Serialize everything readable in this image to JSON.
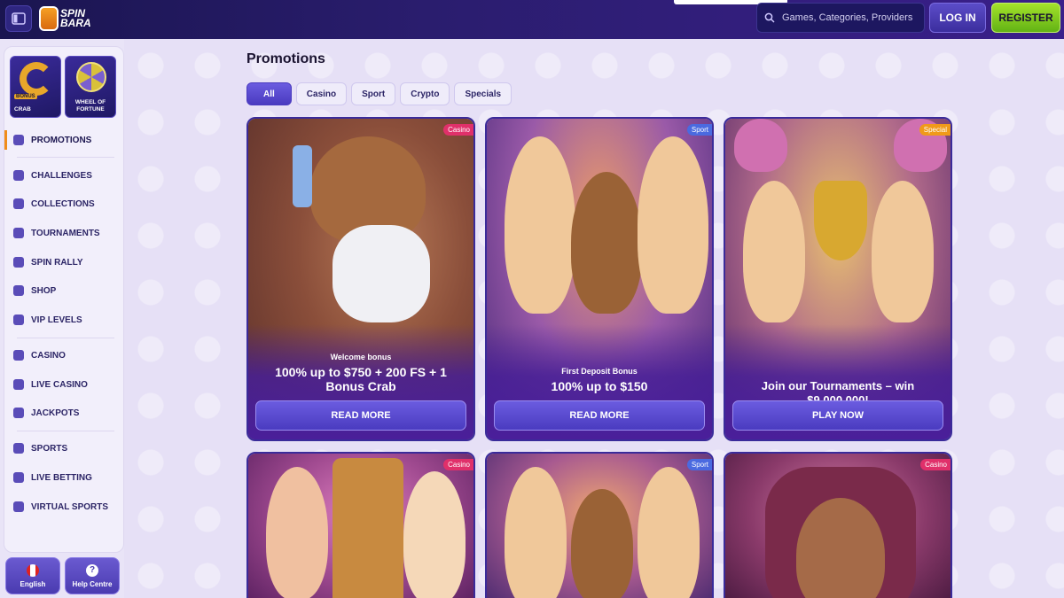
{
  "header": {
    "logo_text_top": "SPIN",
    "logo_text_bottom": "BARA",
    "search_placeholder": "Games, Categories, Providers",
    "login_label": "LOG IN",
    "register_label": "REGISTER"
  },
  "sidebar": {
    "tiles": [
      {
        "label": "CRAB",
        "tag": "BONUS"
      },
      {
        "label": "WHEEL OF FORTUNE"
      }
    ],
    "items": [
      {
        "label": "PROMOTIONS",
        "icon": "gift-icon"
      },
      {
        "label": "CHALLENGES",
        "icon": "target-icon"
      },
      {
        "label": "COLLECTIONS",
        "icon": "cards-icon"
      },
      {
        "label": "TOURNAMENTS",
        "icon": "trophy-icon"
      },
      {
        "label": "SPIN RALLY",
        "icon": "flag-icon"
      },
      {
        "label": "SHOP",
        "icon": "bag-icon"
      },
      {
        "label": "VIP LEVELS",
        "icon": "crown-icon"
      },
      {
        "label": "CASINO",
        "icon": "slot-icon"
      },
      {
        "label": "LIVE CASINO",
        "icon": "roulette-icon"
      },
      {
        "label": "JACKPOTS",
        "icon": "jackpot-icon"
      },
      {
        "label": "SPORTS",
        "icon": "ball-icon"
      },
      {
        "label": "LIVE BETTING",
        "icon": "live-icon"
      },
      {
        "label": "VIRTUAL SPORTS",
        "icon": "monitor-icon"
      }
    ],
    "language_label": "English",
    "help_label": "Help Centre"
  },
  "main": {
    "title": "Promotions",
    "filters": [
      "All",
      "Casino",
      "Sport",
      "Crypto",
      "Specials"
    ],
    "cards": [
      {
        "tag": "Casino",
        "subtitle": "Welcome bonus",
        "title": "100% up to $750 + 200 FS + 1 Bonus Crab",
        "button": "READ MORE"
      },
      {
        "tag": "Sport",
        "subtitle": "First Deposit Bonus",
        "title": "100% up to $150",
        "button": "READ MORE"
      },
      {
        "tag": "Special",
        "subtitle": "",
        "title": "Join our Tournaments – win $9,000,000!",
        "button": "PLAY NOW"
      },
      {
        "tag": "Casino"
      },
      {
        "tag": "Sport"
      },
      {
        "tag": "Casino"
      }
    ]
  },
  "colors": {
    "accent": "#4a3bc0",
    "register": "#8fd11f",
    "header_bg": "#2a1d6e",
    "active_marker": "#f08c1a"
  }
}
